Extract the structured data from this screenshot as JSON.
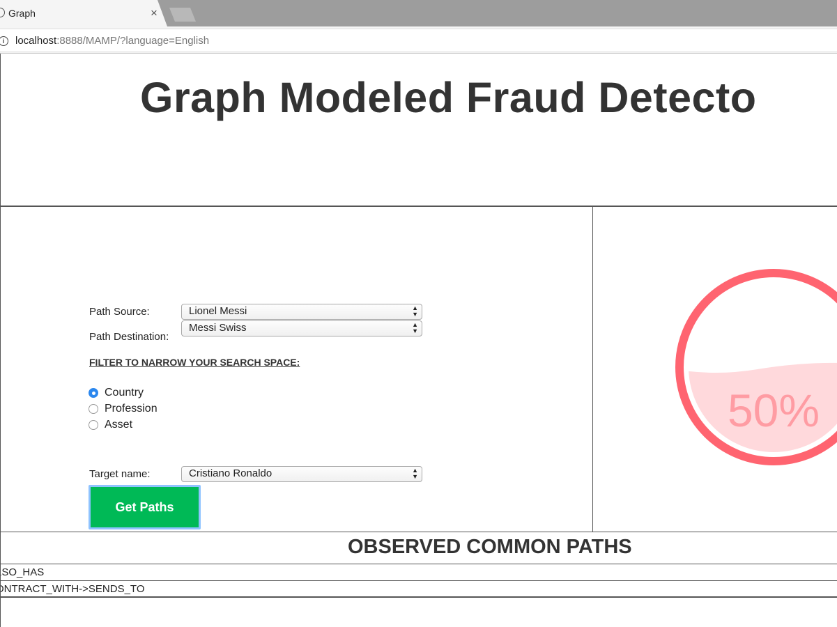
{
  "browser": {
    "tab_title": "Graph",
    "tab_close": "×",
    "url_host": "localhost",
    "url_path": ":8888/MAMP/?language=English"
  },
  "page": {
    "title": "Graph Modeled Fraud Detecto",
    "form": {
      "source_label": "Path Source:",
      "source_value": "Lionel Messi",
      "destination_label": "Path Destination:",
      "destination_value": "Messi Swiss",
      "filter_heading": "FILTER TO NARROW YOUR SEARCH SPACE:",
      "filters": [
        {
          "label": "Country",
          "checked": true
        },
        {
          "label": "Profession",
          "checked": false
        },
        {
          "label": "Asset",
          "checked": false
        }
      ],
      "target_label": "Target name:",
      "target_value": "Cristiano Ronaldo",
      "submit_label": "Get Paths"
    },
    "gauge": {
      "value": 50,
      "text": "50%",
      "ring_color": "#ff6470",
      "fill_color": "#ffd9dc",
      "text_color": "#ff9ca3"
    },
    "paths": {
      "title": "OBSERVED COMMON PATHS",
      "rows": [
        "LSO_HAS",
        "ONTRACT_WITH->SENDS_TO"
      ]
    }
  }
}
